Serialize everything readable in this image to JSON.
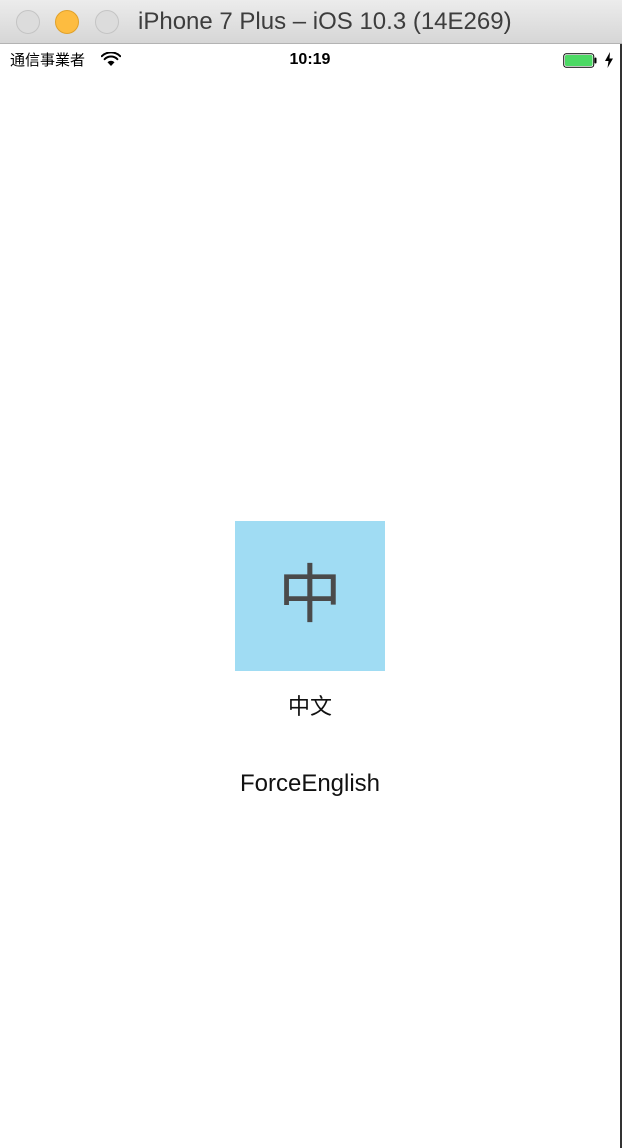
{
  "window": {
    "title": "iPhone 7 Plus – iOS 10.3 (14E269)"
  },
  "status_bar": {
    "carrier": "通信事業者",
    "time": "10:19",
    "battery_level": 1.0,
    "battery_color": "#4cd964",
    "charging": true
  },
  "main": {
    "tile_glyph": "中",
    "tile_color": "#a0dcf3",
    "language_label": "中文",
    "force_english_label": "ForceEnglish"
  }
}
